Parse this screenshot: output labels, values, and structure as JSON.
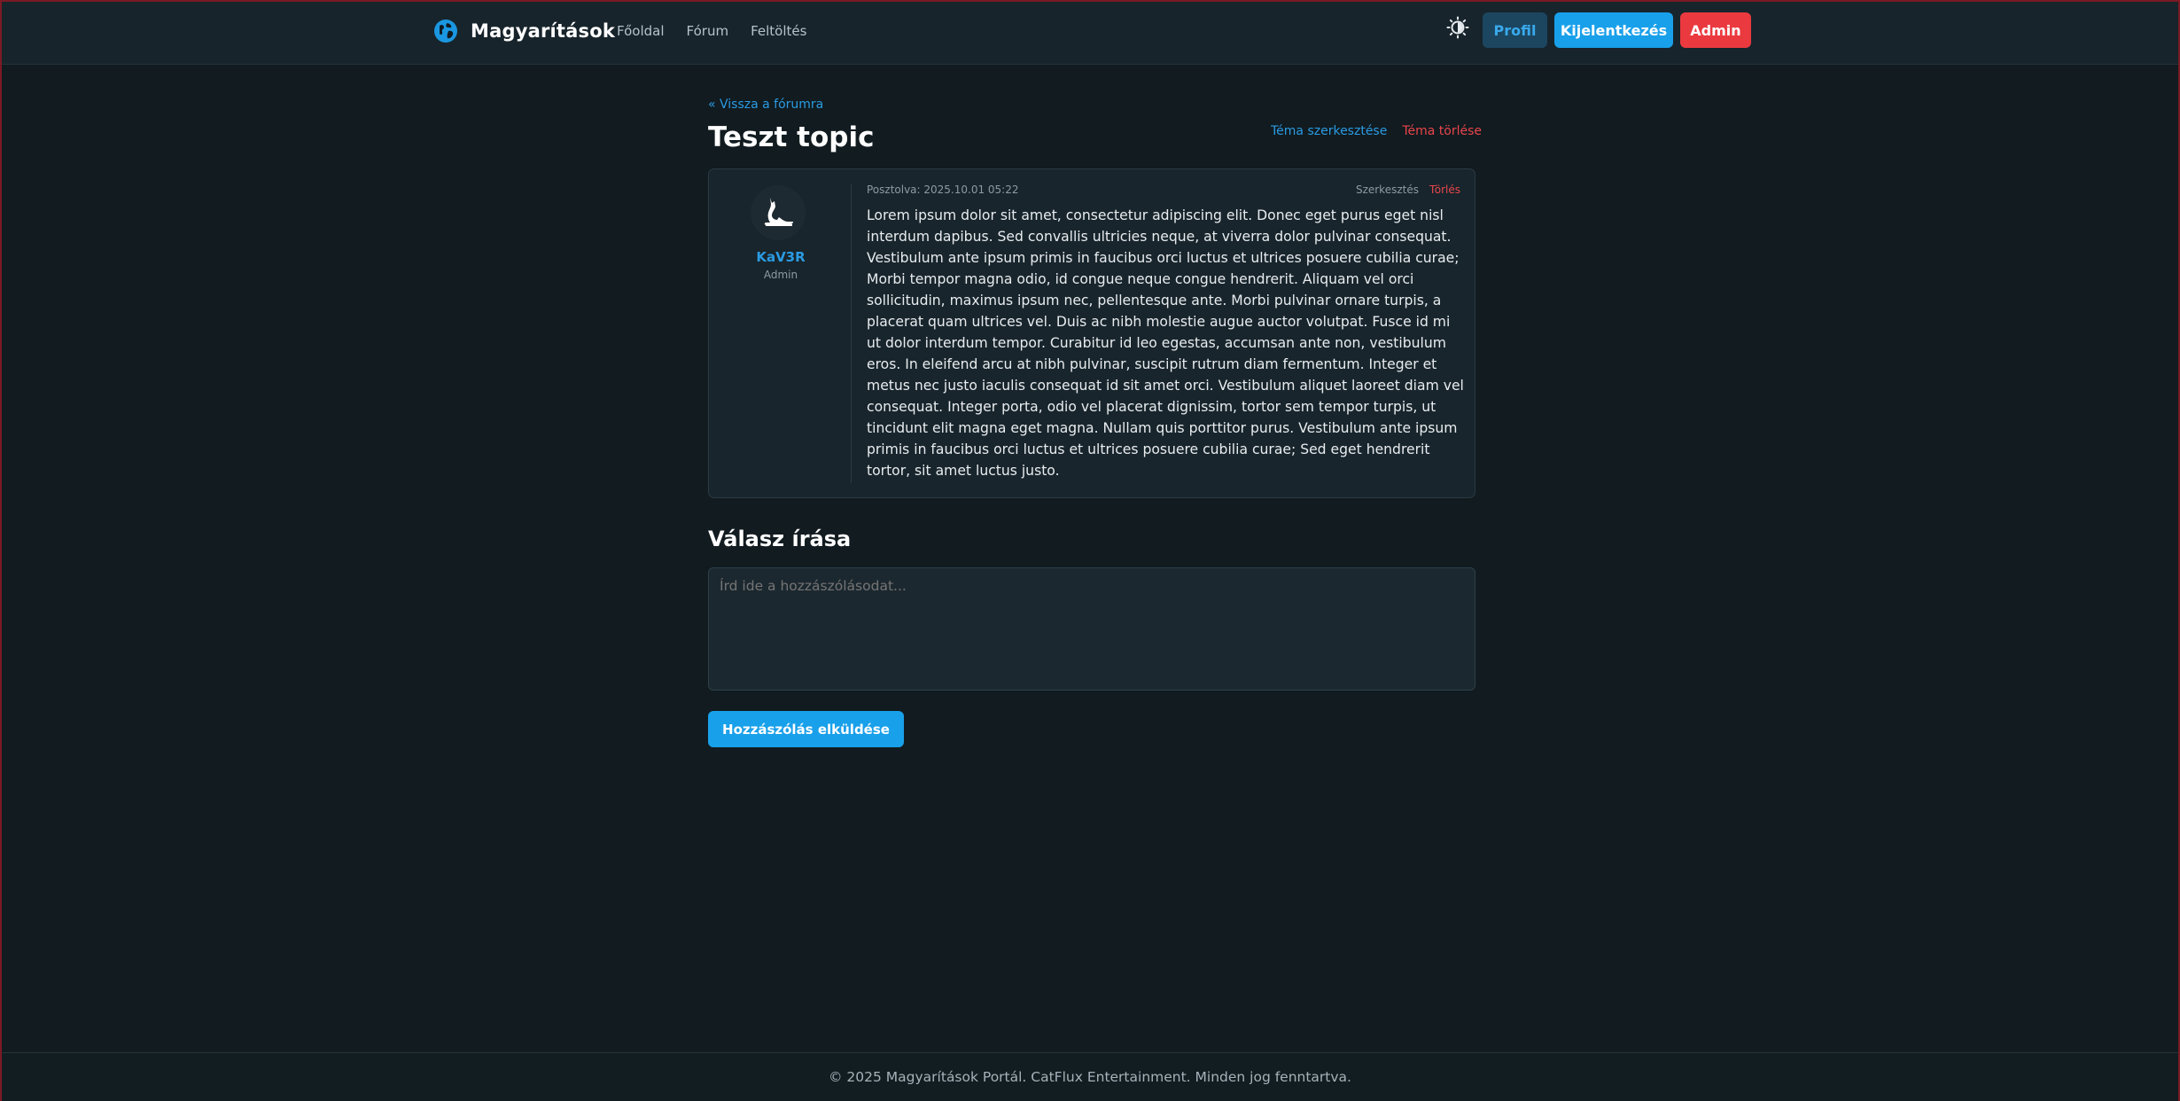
{
  "header": {
    "brand": "Magyarítások",
    "nav": [
      "Főoldal",
      "Fórum",
      "Feltöltés"
    ],
    "buttons": {
      "profile": "Profil",
      "logout": "Kijelentkezés",
      "admin": "Admin"
    }
  },
  "topic": {
    "back_link": "« Vissza a fórumra",
    "title": "Teszt topic",
    "edit_label": "Téma szerkesztése",
    "delete_label": "Téma törlése"
  },
  "post": {
    "author": "KaV3R",
    "role": "Admin",
    "meta": "Posztolva: 2025.10.01 05:22",
    "edit_label": "Szerkesztés",
    "delete_label": "Törlés",
    "body": "Lorem ipsum dolor sit amet, consectetur adipiscing elit. Donec eget purus eget nisl interdum dapibus. Sed convallis ultricies neque, at viverra dolor pulvinar consequat. Vestibulum ante ipsum primis in faucibus orci luctus et ultrices posuere cubilia curae; Morbi tempor magna odio, id congue neque congue hendrerit. Aliquam vel orci sollicitudin, maximus ipsum nec, pellentesque ante. Morbi pulvinar ornare turpis, a placerat quam ultrices vel. Duis ac nibh molestie augue auctor volutpat. Fusce id mi ut dolor interdum tempor. Curabitur id leo egestas, accumsan ante non, vestibulum eros. In eleifend arcu at nibh pulvinar, suscipit rutrum diam fermentum. Integer et metus nec justo iaculis consequat id sit amet orci. Vestibulum aliquet laoreet diam vel consequat. Integer porta, odio vel placerat dignissim, tortor sem tempor turpis, ut tincidunt elit magna eget magna. Nullam quis porttitor purus. Vestibulum ante ipsum primis in faucibus orci luctus et ultrices posuere cubilia curae; Sed eget hendrerit tortor, sit amet luctus justo."
  },
  "reply": {
    "title": "Válasz írása",
    "placeholder": "Írd ide a hozzászólásodat...",
    "value": "",
    "submit_label": "Hozzászólás elküldése"
  },
  "footer": {
    "text": "© 2025 Magyarítások Portál. CatFlux Entertainment. Minden jog fenntartva."
  },
  "colors": {
    "accent": "#19a0ea",
    "danger": "#ea3a3f",
    "background": "#111b20",
    "surface": "#18252c"
  },
  "icons": {
    "brand": "globe-icon",
    "theme": "theme-toggle-icon",
    "avatar": "cat-avatar"
  }
}
